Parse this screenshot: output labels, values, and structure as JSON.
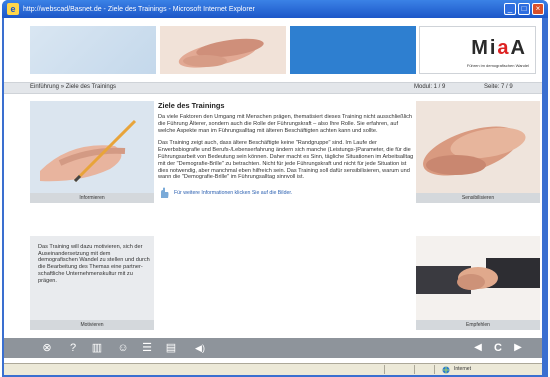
{
  "window": {
    "title": "http://webscad/Basnet.de - Ziele des Trainings - Microsoft Internet Explorer",
    "min": "_",
    "max": "□",
    "close": "×"
  },
  "logo": {
    "text_a": "Mi",
    "text_b": "a",
    "text_c": "A",
    "subtitle": "Führen im demografischen Wandel"
  },
  "nav": {
    "breadcrumb": "Einführung » Ziele des Trainings",
    "modul": "Modul: 1 / 9",
    "seite": "Seite: 7 / 9"
  },
  "left": {
    "caption_top": "Informieren",
    "text": "Das Training will dazu motivieren, sich der Auseinandersetzung mit dem demografischen Wandel zu stellen und durch die Bearbeitung des Themas eine partner-schaftliche Unternehmenskultur mit zu prägen.",
    "caption_bottom": "Motivieren"
  },
  "right": {
    "caption_top": "Sensibilisieren",
    "caption_bottom": "Empfehlen"
  },
  "main": {
    "heading": "Ziele des Trainings",
    "p1": "Da viele Faktoren den Umgang mit Menschen prägen, thematisiert dieses Training nicht ausschließlich die Führung Älterer, sondern auch die Rolle der Führungskraft – also Ihre Rolle. Sie erfahren, auf welche Aspekte man im Führungsalltag mit älteren Beschäftigten achten kann und sollte.",
    "p2": "Das Training zeigt auch, dass ältere Beschäftigte keine \"Randgruppe\" sind. Im Laufe der Erwerbsbiografie und Berufs-/Lebenserfahrung ändern sich manche (Leistungs-)Parameter, die für die Führungsarbeit von Bedeutung sein können. Daher macht es Sinn, tägliche Situationen im Arbeitsalltag mit der \"Demografie-Brille\" zu betrachten. Nicht für jede Führungskraft und nicht für jede Situation ist dies notwendig, aber manchmal eben hilfreich sein. Das Training soll dafür sensibilisieren, warum und wann die \"Demografie-Brille\" im Führungsalltag sinnvoll ist.",
    "hint": "Für weitere Informationen klicken Sie auf die Bilder."
  },
  "toolbar": {
    "close": "⊗",
    "help": "?",
    "book": "▥",
    "people": "☺",
    "list": "☰",
    "notes": "▤",
    "sound": "◀)",
    "prev": "◀",
    "reload": "C",
    "next": "▶"
  },
  "status": {
    "zone": "Internet"
  },
  "colors": {
    "accent_blue": "#2e7fd0",
    "light_blue": "#c9def0",
    "toolbar": "#8e949b"
  }
}
